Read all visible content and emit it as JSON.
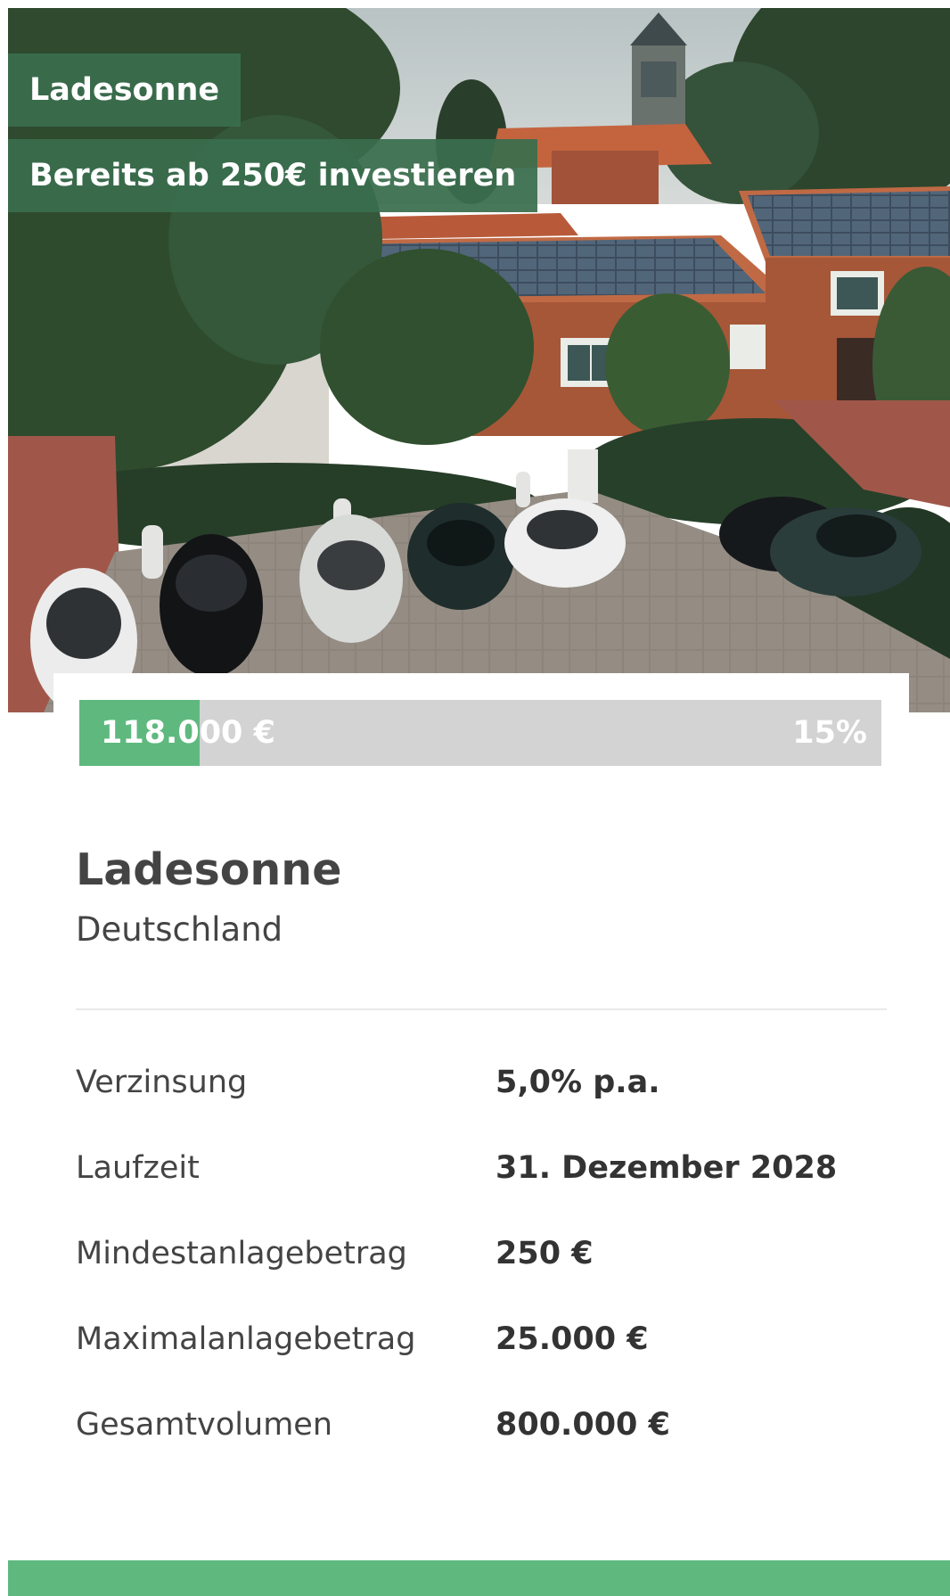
{
  "hero": {
    "tag_name": "Ladesonne",
    "tag_invest": "Bereits ab 250€ investieren",
    "image_subject": "aerial photo of brick buildings with rooftop solar panels and electric cars parked at charging stations"
  },
  "funding": {
    "amount": "118.000 €",
    "percent_label": "15%",
    "progress": 0.15,
    "colors": {
      "fill": "#5fb97f",
      "track": "#d3d3d3"
    }
  },
  "project": {
    "name": "Ladesonne",
    "country": "Deutschland"
  },
  "facts": [
    {
      "label": "Verzinsung",
      "value": "5,0% p.a."
    },
    {
      "label": "Laufzeit",
      "value": "31. Dezember 2028"
    },
    {
      "label": "Mindestanlagebetrag",
      "value": "250 €"
    },
    {
      "label": "Maximalanlagebetrag",
      "value": "25.000 €"
    },
    {
      "label": "Gesamtvolumen",
      "value": "800.000 €"
    }
  ],
  "colors": {
    "brand_dark_green": "#3a6e4e",
    "brand_green": "#5fb97f",
    "text": "#333333"
  }
}
